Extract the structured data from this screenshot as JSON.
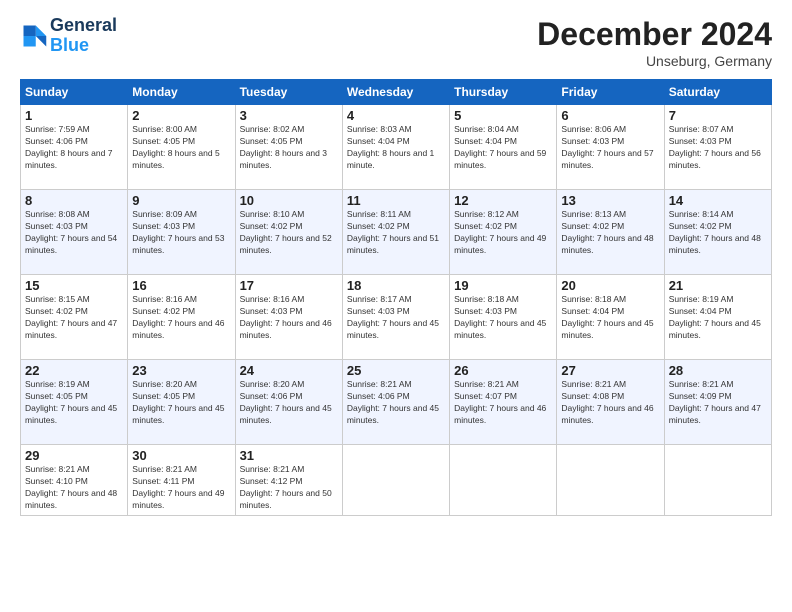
{
  "header": {
    "logo_line1": "General",
    "logo_line2": "Blue",
    "month": "December 2024",
    "location": "Unseburg, Germany"
  },
  "weekdays": [
    "Sunday",
    "Monday",
    "Tuesday",
    "Wednesday",
    "Thursday",
    "Friday",
    "Saturday"
  ],
  "weeks": [
    [
      {
        "day": 1,
        "sunrise": "Sunrise: 7:59 AM",
        "sunset": "Sunset: 4:06 PM",
        "daylight": "Daylight: 8 hours and 7 minutes."
      },
      {
        "day": 2,
        "sunrise": "Sunrise: 8:00 AM",
        "sunset": "Sunset: 4:05 PM",
        "daylight": "Daylight: 8 hours and 5 minutes."
      },
      {
        "day": 3,
        "sunrise": "Sunrise: 8:02 AM",
        "sunset": "Sunset: 4:05 PM",
        "daylight": "Daylight: 8 hours and 3 minutes."
      },
      {
        "day": 4,
        "sunrise": "Sunrise: 8:03 AM",
        "sunset": "Sunset: 4:04 PM",
        "daylight": "Daylight: 8 hours and 1 minute."
      },
      {
        "day": 5,
        "sunrise": "Sunrise: 8:04 AM",
        "sunset": "Sunset: 4:04 PM",
        "daylight": "Daylight: 7 hours and 59 minutes."
      },
      {
        "day": 6,
        "sunrise": "Sunrise: 8:06 AM",
        "sunset": "Sunset: 4:03 PM",
        "daylight": "Daylight: 7 hours and 57 minutes."
      },
      {
        "day": 7,
        "sunrise": "Sunrise: 8:07 AM",
        "sunset": "Sunset: 4:03 PM",
        "daylight": "Daylight: 7 hours and 56 minutes."
      }
    ],
    [
      {
        "day": 8,
        "sunrise": "Sunrise: 8:08 AM",
        "sunset": "Sunset: 4:03 PM",
        "daylight": "Daylight: 7 hours and 54 minutes."
      },
      {
        "day": 9,
        "sunrise": "Sunrise: 8:09 AM",
        "sunset": "Sunset: 4:03 PM",
        "daylight": "Daylight: 7 hours and 53 minutes."
      },
      {
        "day": 10,
        "sunrise": "Sunrise: 8:10 AM",
        "sunset": "Sunset: 4:02 PM",
        "daylight": "Daylight: 7 hours and 52 minutes."
      },
      {
        "day": 11,
        "sunrise": "Sunrise: 8:11 AM",
        "sunset": "Sunset: 4:02 PM",
        "daylight": "Daylight: 7 hours and 51 minutes."
      },
      {
        "day": 12,
        "sunrise": "Sunrise: 8:12 AM",
        "sunset": "Sunset: 4:02 PM",
        "daylight": "Daylight: 7 hours and 49 minutes."
      },
      {
        "day": 13,
        "sunrise": "Sunrise: 8:13 AM",
        "sunset": "Sunset: 4:02 PM",
        "daylight": "Daylight: 7 hours and 48 minutes."
      },
      {
        "day": 14,
        "sunrise": "Sunrise: 8:14 AM",
        "sunset": "Sunset: 4:02 PM",
        "daylight": "Daylight: 7 hours and 48 minutes."
      }
    ],
    [
      {
        "day": 15,
        "sunrise": "Sunrise: 8:15 AM",
        "sunset": "Sunset: 4:02 PM",
        "daylight": "Daylight: 7 hours and 47 minutes."
      },
      {
        "day": 16,
        "sunrise": "Sunrise: 8:16 AM",
        "sunset": "Sunset: 4:02 PM",
        "daylight": "Daylight: 7 hours and 46 minutes."
      },
      {
        "day": 17,
        "sunrise": "Sunrise: 8:16 AM",
        "sunset": "Sunset: 4:03 PM",
        "daylight": "Daylight: 7 hours and 46 minutes."
      },
      {
        "day": 18,
        "sunrise": "Sunrise: 8:17 AM",
        "sunset": "Sunset: 4:03 PM",
        "daylight": "Daylight: 7 hours and 45 minutes."
      },
      {
        "day": 19,
        "sunrise": "Sunrise: 8:18 AM",
        "sunset": "Sunset: 4:03 PM",
        "daylight": "Daylight: 7 hours and 45 minutes."
      },
      {
        "day": 20,
        "sunrise": "Sunrise: 8:18 AM",
        "sunset": "Sunset: 4:04 PM",
        "daylight": "Daylight: 7 hours and 45 minutes."
      },
      {
        "day": 21,
        "sunrise": "Sunrise: 8:19 AM",
        "sunset": "Sunset: 4:04 PM",
        "daylight": "Daylight: 7 hours and 45 minutes."
      }
    ],
    [
      {
        "day": 22,
        "sunrise": "Sunrise: 8:19 AM",
        "sunset": "Sunset: 4:05 PM",
        "daylight": "Daylight: 7 hours and 45 minutes."
      },
      {
        "day": 23,
        "sunrise": "Sunrise: 8:20 AM",
        "sunset": "Sunset: 4:05 PM",
        "daylight": "Daylight: 7 hours and 45 minutes."
      },
      {
        "day": 24,
        "sunrise": "Sunrise: 8:20 AM",
        "sunset": "Sunset: 4:06 PM",
        "daylight": "Daylight: 7 hours and 45 minutes."
      },
      {
        "day": 25,
        "sunrise": "Sunrise: 8:21 AM",
        "sunset": "Sunset: 4:06 PM",
        "daylight": "Daylight: 7 hours and 45 minutes."
      },
      {
        "day": 26,
        "sunrise": "Sunrise: 8:21 AM",
        "sunset": "Sunset: 4:07 PM",
        "daylight": "Daylight: 7 hours and 46 minutes."
      },
      {
        "day": 27,
        "sunrise": "Sunrise: 8:21 AM",
        "sunset": "Sunset: 4:08 PM",
        "daylight": "Daylight: 7 hours and 46 minutes."
      },
      {
        "day": 28,
        "sunrise": "Sunrise: 8:21 AM",
        "sunset": "Sunset: 4:09 PM",
        "daylight": "Daylight: 7 hours and 47 minutes."
      }
    ],
    [
      {
        "day": 29,
        "sunrise": "Sunrise: 8:21 AM",
        "sunset": "Sunset: 4:10 PM",
        "daylight": "Daylight: 7 hours and 48 minutes."
      },
      {
        "day": 30,
        "sunrise": "Sunrise: 8:21 AM",
        "sunset": "Sunset: 4:11 PM",
        "daylight": "Daylight: 7 hours and 49 minutes."
      },
      {
        "day": 31,
        "sunrise": "Sunrise: 8:21 AM",
        "sunset": "Sunset: 4:12 PM",
        "daylight": "Daylight: 7 hours and 50 minutes."
      },
      null,
      null,
      null,
      null
    ]
  ]
}
